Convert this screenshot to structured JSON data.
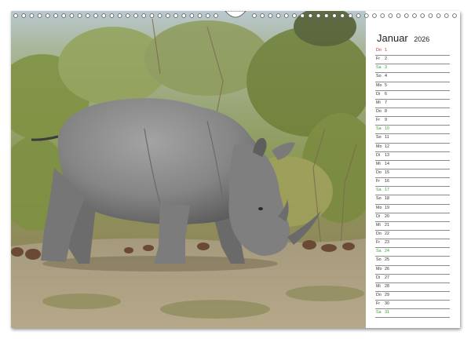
{
  "calendar": {
    "month": "Januar",
    "year": "2026",
    "days": [
      {
        "wd": "Do",
        "d": "1",
        "type": "holiday"
      },
      {
        "wd": "Fr",
        "d": "2",
        "type": "weekday"
      },
      {
        "wd": "Sa",
        "d": "3",
        "type": "sat"
      },
      {
        "wd": "So",
        "d": "4",
        "type": "sun"
      },
      {
        "wd": "Mo",
        "d": "5",
        "type": "weekday"
      },
      {
        "wd": "Di",
        "d": "6",
        "type": "weekday"
      },
      {
        "wd": "Mi",
        "d": "7",
        "type": "weekday"
      },
      {
        "wd": "Do",
        "d": "8",
        "type": "weekday"
      },
      {
        "wd": "Fr",
        "d": "9",
        "type": "weekday"
      },
      {
        "wd": "Sa",
        "d": "10",
        "type": "sat"
      },
      {
        "wd": "So",
        "d": "11",
        "type": "sun"
      },
      {
        "wd": "Mo",
        "d": "12",
        "type": "weekday"
      },
      {
        "wd": "Di",
        "d": "13",
        "type": "weekday"
      },
      {
        "wd": "Mi",
        "d": "14",
        "type": "weekday"
      },
      {
        "wd": "Do",
        "d": "15",
        "type": "weekday"
      },
      {
        "wd": "Fr",
        "d": "16",
        "type": "weekday"
      },
      {
        "wd": "Sa",
        "d": "17",
        "type": "sat"
      },
      {
        "wd": "So",
        "d": "18",
        "type": "sun"
      },
      {
        "wd": "Mo",
        "d": "19",
        "type": "weekday"
      },
      {
        "wd": "Di",
        "d": "20",
        "type": "weekday"
      },
      {
        "wd": "Mi",
        "d": "21",
        "type": "weekday"
      },
      {
        "wd": "Do",
        "d": "22",
        "type": "weekday"
      },
      {
        "wd": "Fr",
        "d": "23",
        "type": "weekday"
      },
      {
        "wd": "Sa",
        "d": "24",
        "type": "sat"
      },
      {
        "wd": "So",
        "d": "25",
        "type": "sun"
      },
      {
        "wd": "Mo",
        "d": "26",
        "type": "weekday"
      },
      {
        "wd": "Di",
        "d": "27",
        "type": "weekday"
      },
      {
        "wd": "Mi",
        "d": "28",
        "type": "weekday"
      },
      {
        "wd": "Do",
        "d": "29",
        "type": "weekday"
      },
      {
        "wd": "Fr",
        "d": "30",
        "type": "weekday"
      },
      {
        "wd": "Sa",
        "d": "31",
        "type": "sat"
      }
    ]
  },
  "colors": {
    "saturday": "#3aa235",
    "holiday": "#c8281e",
    "rule_line": "#8a8a8a"
  },
  "photo": {
    "subject": "rhinoceros-photo"
  }
}
